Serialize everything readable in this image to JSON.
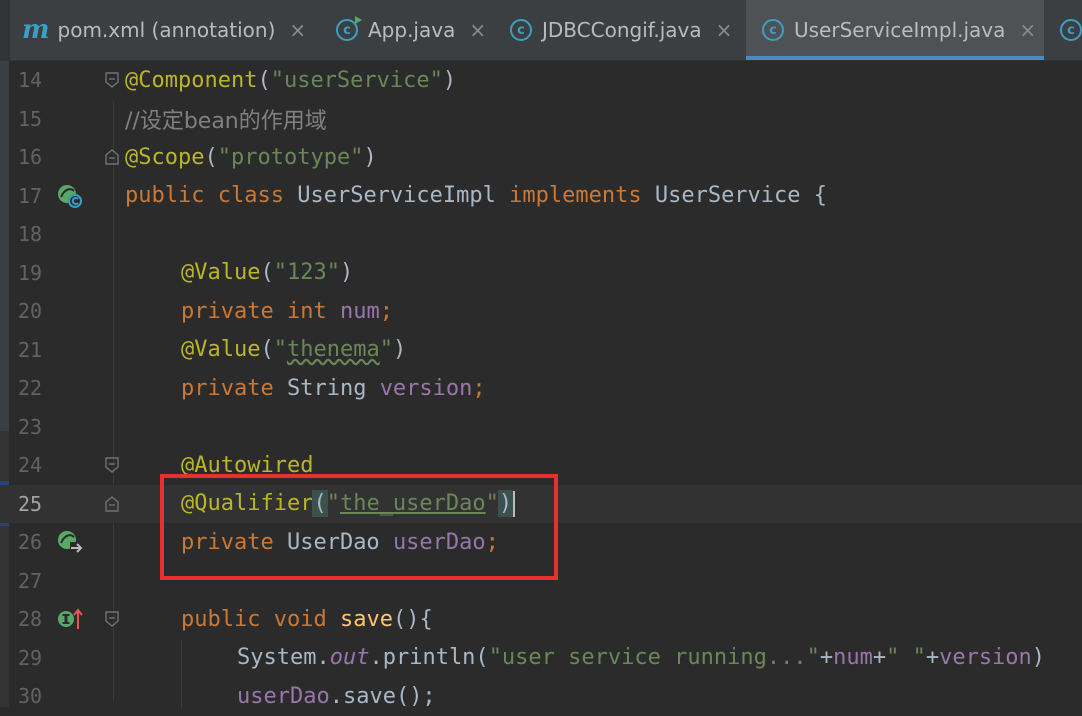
{
  "tabs": [
    {
      "label": "pom.xml (annotation)",
      "icon": "maven-m-icon",
      "active": false
    },
    {
      "label": "App.java",
      "icon": "class-runnable-icon",
      "active": false
    },
    {
      "label": "JDBCCongif.java",
      "icon": "class-icon",
      "active": false
    },
    {
      "label": "UserServiceImpl.java",
      "icon": "class-icon",
      "active": true
    },
    {
      "label": "",
      "icon": "class-icon",
      "active": false
    }
  ],
  "close_glyph": "×",
  "icon_letters": {
    "maven": "m",
    "class": "c"
  },
  "editor": {
    "current_line": "25",
    "lines": [
      {
        "n": "14",
        "t": {
          "a": "@Component",
          "b": "(",
          "c": "\"userService\"",
          "d": ")"
        }
      },
      {
        "n": "15",
        "t": {
          "a": "//设定bean的作用域"
        }
      },
      {
        "n": "16",
        "t": {
          "a": "@Scope",
          "b": "(",
          "c": "\"prototype\"",
          "d": ")"
        }
      },
      {
        "n": "17",
        "t": {
          "a": "public",
          "b": " ",
          "c": "class",
          "d": " UserServiceImpl ",
          "e": "implements",
          "f": " UserService {"
        }
      },
      {
        "n": "18",
        "t": {}
      },
      {
        "n": "19",
        "t": {
          "a": "@Value",
          "b": "(",
          "c": "\"123\"",
          "d": ")"
        }
      },
      {
        "n": "20",
        "t": {
          "a": "private",
          "b": " ",
          "c": "int",
          "d": " ",
          "e": "num",
          "f": ";"
        }
      },
      {
        "n": "21",
        "t": {
          "a": "@Value",
          "b": "(",
          "c": "\"",
          "d": "thenema",
          "e": "\"",
          "f": ")"
        }
      },
      {
        "n": "22",
        "t": {
          "a": "private",
          "b": " String ",
          "c": "version",
          "d": ";"
        }
      },
      {
        "n": "23",
        "t": {}
      },
      {
        "n": "24",
        "t": {
          "a": "@Autowired"
        }
      },
      {
        "n": "25",
        "t": {
          "a": "@Qualifier",
          "b": "(",
          "c": "\"",
          "d": "the_userDao",
          "e": "\"",
          "f": ")"
        }
      },
      {
        "n": "26",
        "t": {
          "a": "private",
          "b": " UserDao ",
          "c": "userDao",
          "d": ";"
        }
      },
      {
        "n": "27",
        "t": {}
      },
      {
        "n": "28",
        "t": {
          "a": "public",
          "b": " ",
          "c": "void",
          "d": " ",
          "e": "save",
          "f": "(){"
        }
      },
      {
        "n": "29",
        "t": {
          "a": "System.",
          "b": "out",
          "c": ".println(",
          "d": "\"user service running...\"",
          "e": "+",
          "f": "num",
          "g": "+",
          "h": "\" \"",
          "i": "+",
          "j": "version",
          "k": ")"
        }
      },
      {
        "n": "30",
        "t": {
          "a": "userDao",
          "b": ".save();"
        }
      }
    ]
  },
  "colors": {
    "background": "#2b2b2b",
    "keyword": "#cc7832",
    "annotation": "#bbb529",
    "string": "#6a8759",
    "field": "#9876aa",
    "method": "#ffc66d",
    "highlight_box": "#e8312f",
    "active_tab_underline": "#4a88c7"
  }
}
